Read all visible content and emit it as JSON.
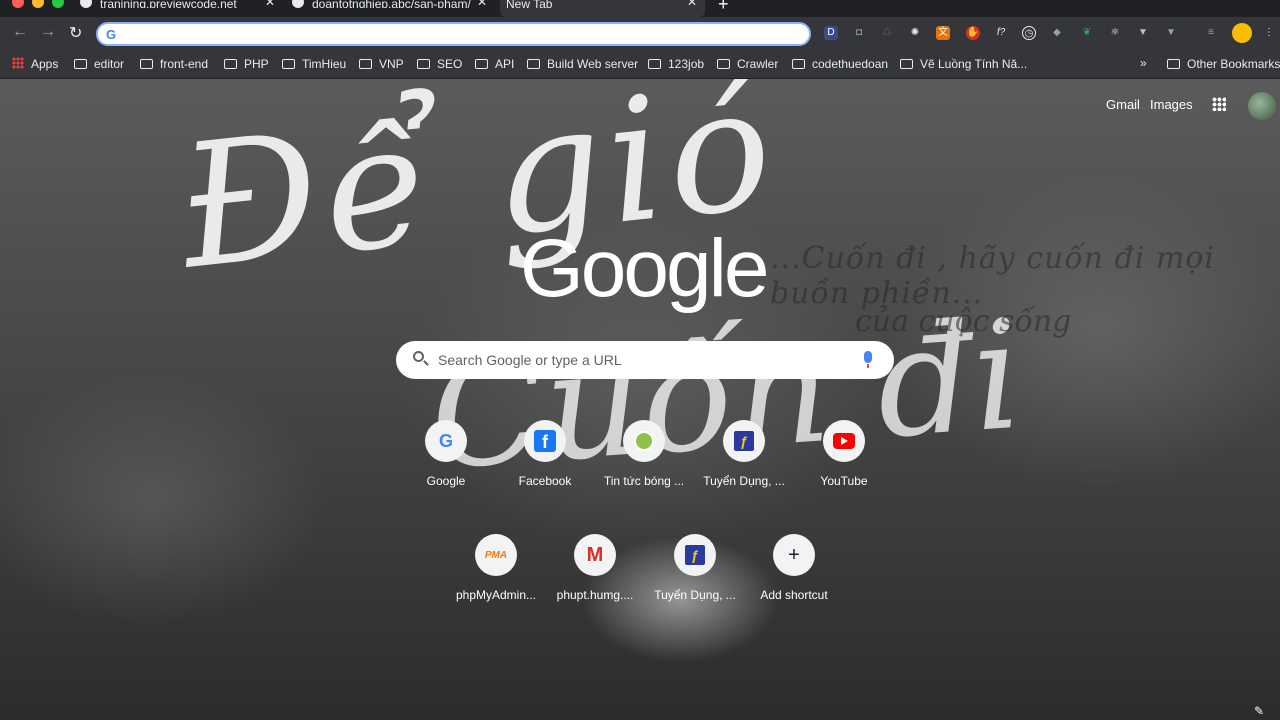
{
  "tabs": [
    {
      "title": "tranining.previewcode.net",
      "active": false
    },
    {
      "title": "doantotnghiep.abc/san-pham/",
      "active": false
    },
    {
      "title": "New Tab",
      "active": true
    }
  ],
  "toolbar": {
    "address_value": "",
    "extensions": [
      "D",
      "camera-icon",
      "recycle-icon",
      "gear-icon",
      "translate-icon",
      "shield-icon",
      "f?",
      "clock-icon",
      "layers-icon",
      "leaf-icon",
      "react-icon",
      "vue-icon",
      "vuex-icon",
      "playlist-icon",
      "avatar-icon"
    ]
  },
  "bookmarks": {
    "apps": "Apps",
    "items": [
      "editor",
      "front-end",
      "PHP",
      "TimHieu",
      "VNP",
      "SEO",
      "API",
      "Build Web server",
      "123job",
      "Crawler",
      "codethuedoan",
      "Vẽ Luồng Tính Nă..."
    ],
    "more": "»",
    "other": "Other Bookmarks"
  },
  "header": {
    "gmail": "Gmail",
    "images": "Images"
  },
  "logo": "Google",
  "search": {
    "placeholder": "Search Google or type a URL"
  },
  "shortcuts": [
    {
      "label": "Google",
      "icon": "google-icon"
    },
    {
      "label": "Facebook",
      "icon": "facebook-icon"
    },
    {
      "label": "Tin tức bóng ...",
      "icon": "football-icon"
    },
    {
      "label": "Tuyển Dụng, ...",
      "icon": "tv-icon"
    },
    {
      "label": "YouTube",
      "icon": "youtube-icon"
    },
    {
      "label": "phpMyAdmin...",
      "icon": "phpmyadmin-icon"
    },
    {
      "label": "phupt.humg....",
      "icon": "gmail-icon"
    },
    {
      "label": "Tuyển Dụng, ...",
      "icon": "tv-icon"
    },
    {
      "label": "Add shortcut",
      "icon": "plus-icon"
    }
  ],
  "wallpaper_text": {
    "line1": "Để gió",
    "line2": "Cuốn đi",
    "line3": "...Cuốn đi , hãy cuốn đi mọi buồn phiền...",
    "line4": "của cuộc sống"
  }
}
